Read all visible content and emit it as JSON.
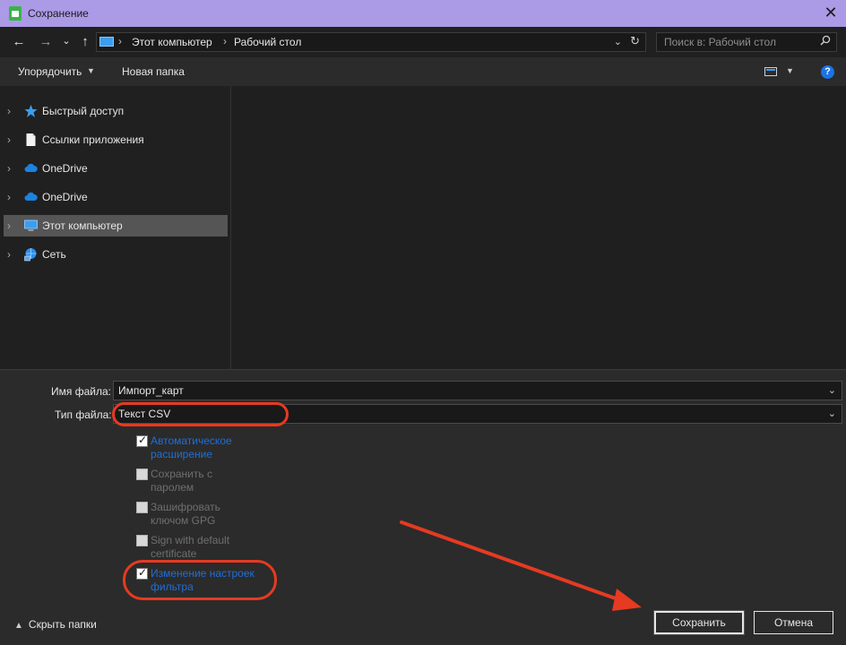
{
  "window": {
    "title": "Сохранение",
    "close_glyph": "✕"
  },
  "nav": {
    "back_glyph": "←",
    "forward_glyph": "→",
    "recent_glyph": "⌄",
    "up_glyph": "↑",
    "breadcrumbs": [
      "Этот компьютер",
      "Рабочий стол"
    ],
    "search_placeholder": "Поиск в: Рабочий стол"
  },
  "toolbar": {
    "organize_label": "Упорядочить",
    "new_folder_label": "Новая папка",
    "help_label": "?"
  },
  "sidebar": {
    "items": [
      {
        "label": "Быстрый доступ",
        "icon": "star-icon"
      },
      {
        "label": "Ссылки приложения",
        "icon": "document-icon"
      },
      {
        "label": "OneDrive",
        "icon": "cloud-icon"
      },
      {
        "label": "OneDrive",
        "icon": "cloud-icon"
      },
      {
        "label": "Этот компьютер",
        "icon": "computer-icon",
        "selected": true
      },
      {
        "label": "Сеть",
        "icon": "network-icon"
      }
    ]
  },
  "form": {
    "filename_label": "Имя файла:",
    "filename_value": "Импорт_карт",
    "filetype_label": "Тип файла:",
    "filetype_value": "Текст CSV",
    "options": [
      {
        "line1": "Автоматическое",
        "line2": "расширение",
        "checked": true,
        "enabled": true
      },
      {
        "line1": "Сохранить с",
        "line2": "паролем",
        "checked": false,
        "enabled": false
      },
      {
        "line1": "Зашифровать",
        "line2": "ключом GPG",
        "checked": false,
        "enabled": false
      },
      {
        "line1": "Sign with default",
        "line2": "certificate",
        "checked": false,
        "enabled": false
      },
      {
        "line1": "Изменение настроек",
        "line2": "фильтра",
        "checked": true,
        "enabled": true
      }
    ]
  },
  "footer": {
    "hide_folders_label": "Скрыть папки",
    "save_label": "Сохранить",
    "cancel_label": "Отмена"
  },
  "colors": {
    "annotation": "#e63a22",
    "link_blue": "#1e6fd9",
    "title_bar": "#ab9ae6"
  }
}
